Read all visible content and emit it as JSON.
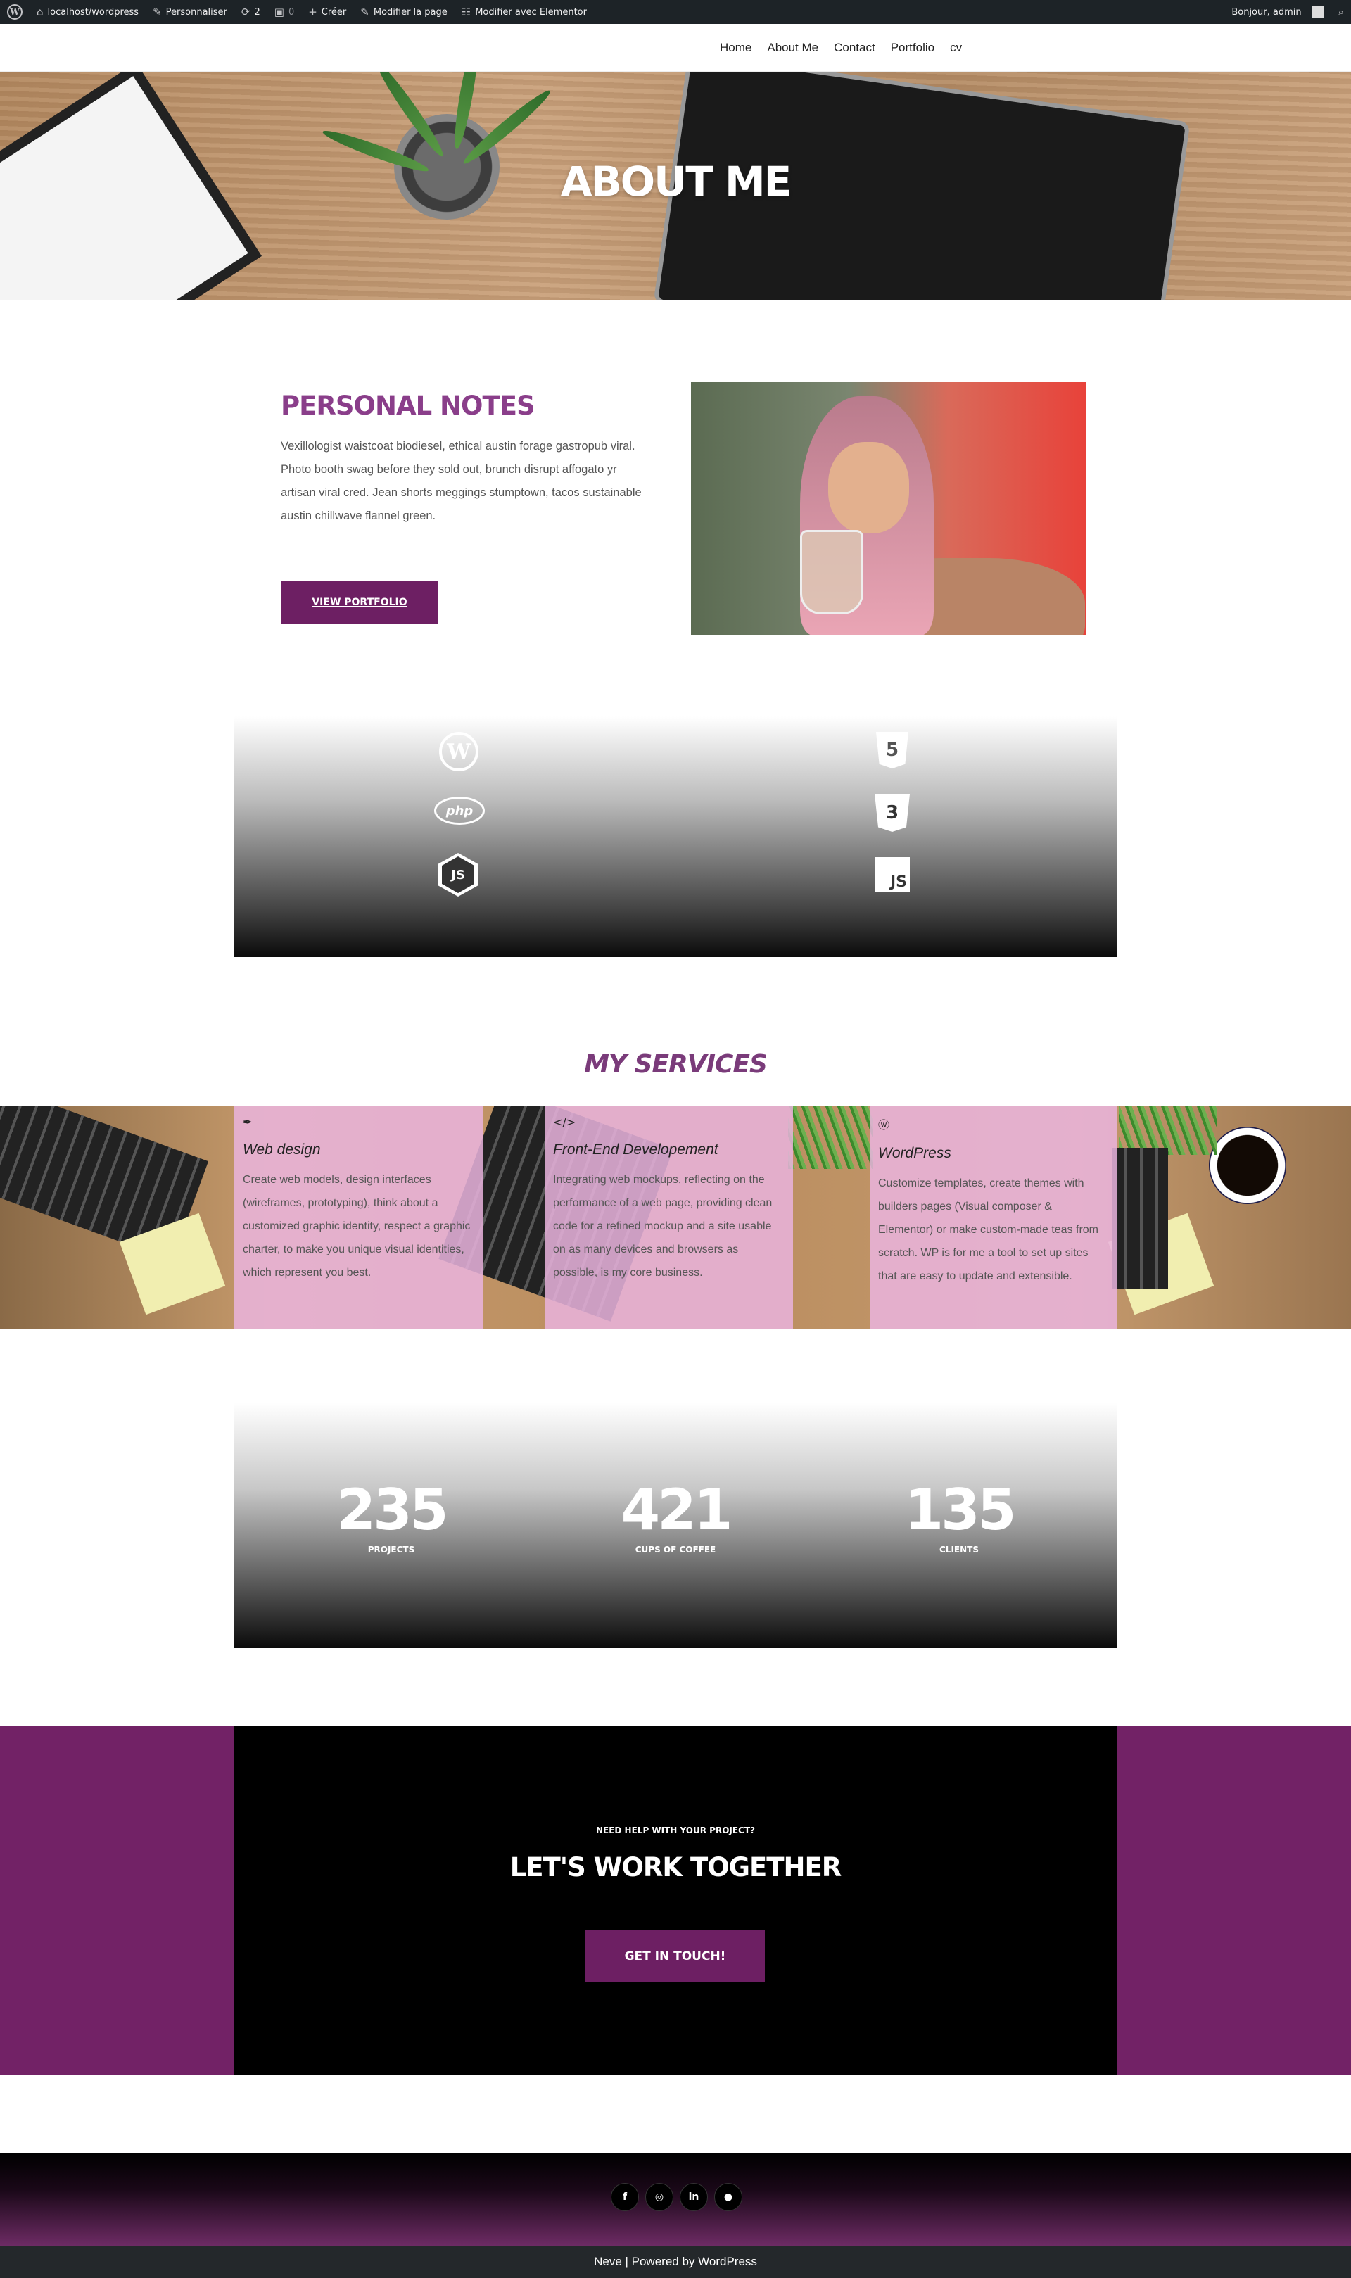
{
  "admin_bar": {
    "site": "localhost/wordpress",
    "customize": "Personnaliser",
    "updates": "2",
    "comments": "0",
    "new": "Créer",
    "edit_page": "Modifier la page",
    "elementor": "Modifier avec Elementor",
    "greeting": "Bonjour, admin"
  },
  "nav": {
    "items": [
      "Home",
      "About Me",
      "Contact",
      "Portfolio",
      "cv"
    ]
  },
  "hero": {
    "title": "ABOUT ME"
  },
  "personal": {
    "title": "PERSONAL NOTES",
    "text": "Vexillologist waistcoat biodiesel, ethical austin forage gastropub viral. Photo booth swag before they sold out, brunch disrupt affogato yr artisan viral cred. Jean shorts meggings stumptown, tacos sustainable austin chillwave flannel green.",
    "button": "VIEW PORTFOLIO"
  },
  "tech_icons": [
    "wordpress-icon",
    "php-icon",
    "nodejs-icon",
    "html5-icon",
    "css3-icon",
    "javascript-icon"
  ],
  "services": {
    "title": "MY SERVICES",
    "items": [
      {
        "icon": "pen-icon",
        "title": "Web design",
        "text": "Create web models, design interfaces (wireframes, prototyping), think about a customized graphic identity, respect a graphic charter, to make you unique visual identities, which represent you best."
      },
      {
        "icon": "code-icon",
        "title": "Front-End Developement",
        "text": "Integrating web mockups, reflecting on the performance of a web page, providing clean code for a refined mockup and a site usable on as many devices and browsers as possible, is my core business."
      },
      {
        "icon": "wordpress-icon",
        "title": "WordPress",
        "text": "Customize templates, create themes with builders pages (Visual composer & Elementor) or make custom-made teas from scratch. WP is for me a tool to set up sites that are easy to update and extensible."
      }
    ]
  },
  "stats": [
    {
      "number": "235",
      "label": "PROJECTS"
    },
    {
      "number": "421",
      "label": "CUPS OF COFFEE"
    },
    {
      "number": "135",
      "label": "CLIENTS"
    }
  ],
  "cta": {
    "kicker": "NEED HELP WITH YOUR PROJECT?",
    "title": "LET'S WORK TOGETHER",
    "button": "GET IN TOUCH!"
  },
  "social": [
    "facebook-icon",
    "instagram-icon",
    "linkedin-icon",
    "github-icon"
  ],
  "footer": {
    "text": "Neve | Powered by WordPress"
  },
  "colors": {
    "accent": "#6d1f63",
    "heading": "#8a3e8a",
    "admin_bar": "#1d2327"
  }
}
